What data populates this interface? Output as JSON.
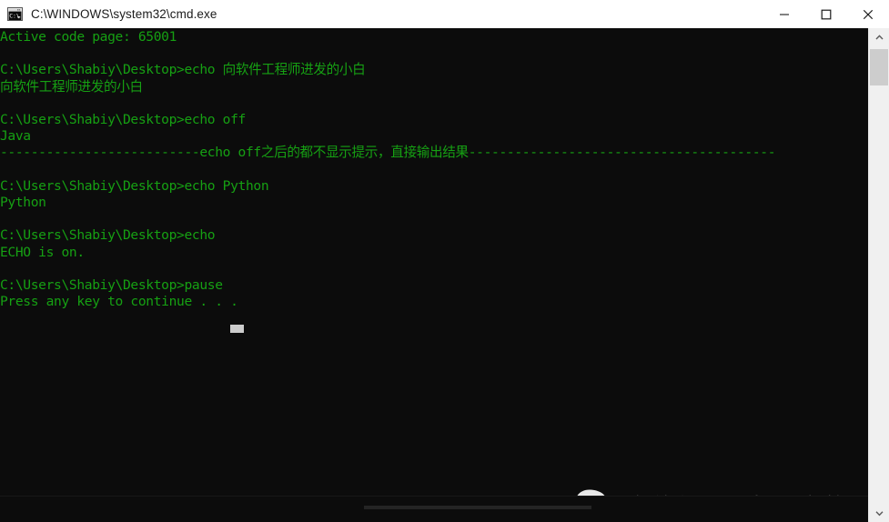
{
  "window": {
    "title": "C:\\WINDOWS\\system32\\cmd.exe",
    "icon": "cmd-icon",
    "background_color": "#0c0c0c",
    "text_color": "#16a013",
    "titlebar_color": "#ffffff",
    "controls": {
      "minimize_label": "—",
      "maximize_label": "□",
      "close_label": "×"
    }
  },
  "console": {
    "lines": [
      "Active code page: 65001",
      "",
      "C:\\Users\\Shabiy\\Desktop>echo 向软件工程师进发的小白",
      "向软件工程师进发的小白",
      "",
      "C:\\Users\\Shabiy\\Desktop>echo off",
      "Java",
      "--------------------------echo off之后的都不显示提示，直接输出结果----------------------------------------",
      "",
      "C:\\Users\\Shabiy\\Desktop>echo Python",
      "Python",
      "",
      "C:\\Users\\Shabiy\\Desktop>echo",
      "ECHO is on.",
      "",
      "C:\\Users\\Shabiy\\Desktop>pause",
      "Press any key to continue . . ."
    ],
    "prompt": "C:\\Users\\Shabiy\\Desktop>",
    "code_page": "65001",
    "commands": [
      "echo 向软件工程师进发的小白",
      "echo off",
      "echo Python",
      "echo",
      "pause"
    ],
    "outputs": [
      "向软件工程师进发的小白",
      "Java",
      "Python",
      "ECHO is on.",
      "Press any key to continue . . ."
    ],
    "annotation": "echo off之后的都不显示提示，直接输出结果",
    "cursor_visible": true
  },
  "scrollbar": {
    "up_arrow": "⌃",
    "down_arrow": "⌄",
    "thumb_color": "#cdcdcd",
    "track_color": "#f0f0f0"
  },
  "watermark": {
    "text": "向软件工程师进发的小白",
    "icon": "wechat-icon",
    "color": "#f2f2f2"
  }
}
